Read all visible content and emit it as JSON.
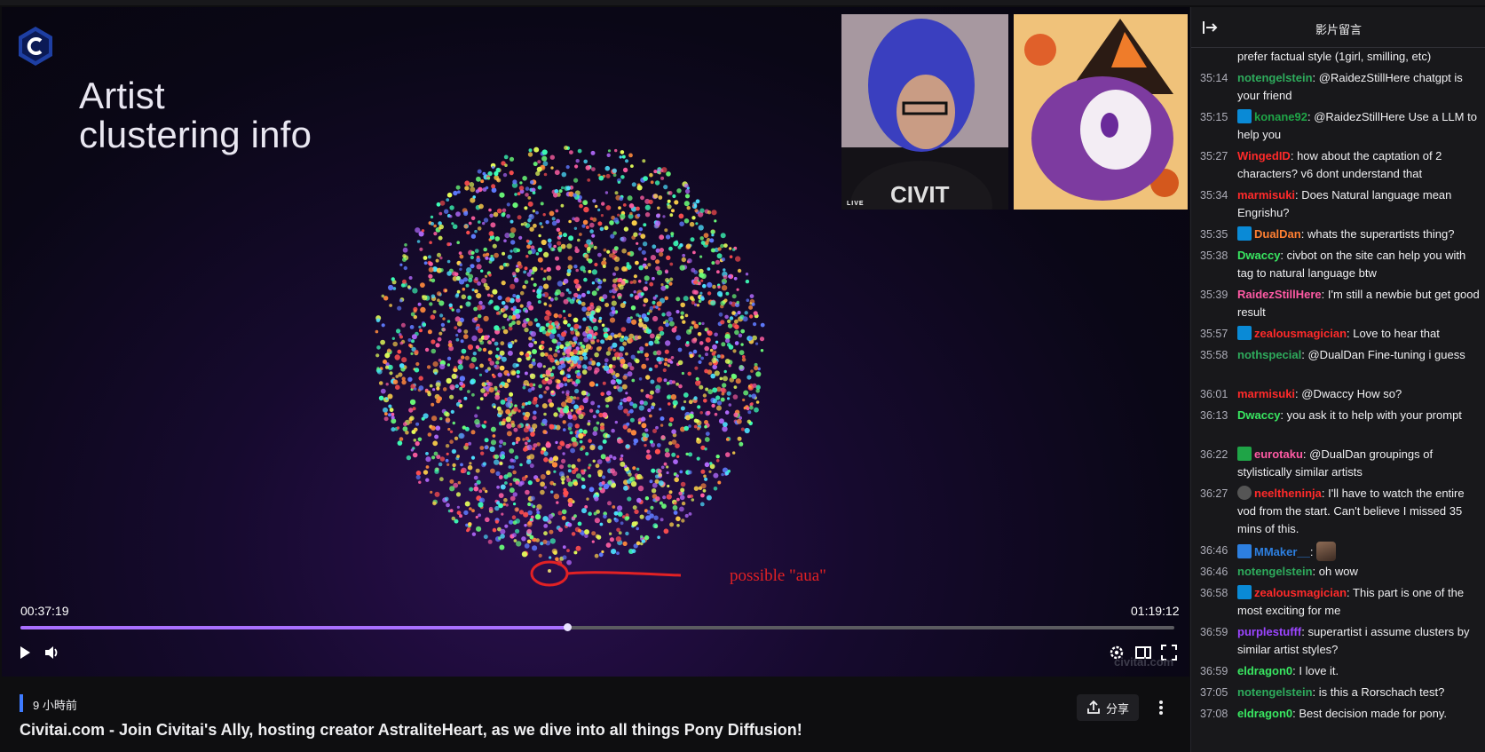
{
  "video": {
    "slide_title_line1": "Artist",
    "slide_title_line2": "clustering info",
    "annotation": "possible \"aua\"",
    "live_tag": "LIVE",
    "current_time": "00:37:19",
    "total_time": "01:19:12",
    "progress": 0.474,
    "watermark": "civitai.com",
    "accent_color": "#a970ff"
  },
  "info": {
    "age": "9 小時前",
    "share_label": "分享",
    "title": "Civitai.com - Join Civitai's Ally, hosting creator AstraliteHeart, as we dive into all things Pony Diffusion!"
  },
  "chat": {
    "title": "影片留言",
    "messages": [
      {
        "ts": "",
        "badge": "",
        "user": "",
        "color": "",
        "text": "prefer factual style (1girl, smilling, etc)"
      },
      {
        "ts": "35:14",
        "badge": "",
        "user": "notengelstein",
        "color": "#2eab5c",
        "text": "@RaidezStillHere chatgpt is your friend"
      },
      {
        "ts": "35:15",
        "badge": "crown",
        "user": "konane92",
        "color": "#1fa447",
        "text": "@RaidezStillHere Use a LLM to help you"
      },
      {
        "ts": "35:27",
        "badge": "",
        "user": "WingedID",
        "color": "#ff2a2a",
        "text": "how about the captation of 2 characters? v6 dont understand that"
      },
      {
        "ts": "35:34",
        "badge": "",
        "user": "marmisuki",
        "color": "#ff2a2a",
        "text": "Does Natural language mean Engrishu?"
      },
      {
        "ts": "35:35",
        "badge": "crown",
        "user": "DualDan",
        "color": "#ff7f32",
        "text": "whats the superartists thing?"
      },
      {
        "ts": "35:38",
        "badge": "",
        "user": "Dwaccy",
        "color": "#39e661",
        "text": "civbot on the site can help you with tag to natural language btw"
      },
      {
        "ts": "35:39",
        "badge": "",
        "user": "RaidezStillHere",
        "color": "#ff5aa4",
        "text": "I'm still a newbie but get good result"
      },
      {
        "ts": "35:57",
        "badge": "crown",
        "user": "zealousmagician",
        "color": "#ff2a2a",
        "text": "Love to hear that"
      },
      {
        "ts": "35:58",
        "badge": "",
        "user": "nothspecial",
        "color": "#2eab5c",
        "text": "@DualDan Fine-tuning i guess"
      },
      {
        "ts": "36:01",
        "badge": "",
        "user": "marmisuki",
        "color": "#ff2a2a",
        "text": "@Dwaccy How so?"
      },
      {
        "ts": "36:13",
        "badge": "",
        "user": "Dwaccy",
        "color": "#39e661",
        "text": "you ask it to help with your prompt"
      },
      {
        "ts": "36:22",
        "badge": "green",
        "user": "eurotaku",
        "color": "#ff5aa4",
        "text": "@DualDan groupings of stylistically similar artists"
      },
      {
        "ts": "36:27",
        "badge": "round",
        "user": "neeltheninja",
        "color": "#ff2a2a",
        "text": "I'll have to watch the entire vod from the start. Can't believe I missed 35 mins of this."
      },
      {
        "ts": "36:46",
        "badge": "blue",
        "user": "MMaker__",
        "color": "#2d7fe0",
        "text": ""
      },
      {
        "ts": "36:46",
        "badge": "",
        "user": "notengelstein",
        "color": "#2eab5c",
        "text": "oh wow"
      },
      {
        "ts": "36:58",
        "badge": "crown",
        "user": "zealousmagician",
        "color": "#ff2a2a",
        "text": "This part is one of the most exciting for me"
      },
      {
        "ts": "36:59",
        "badge": "",
        "user": "purplestufff",
        "color": "#9b45ff",
        "text": "superartist i assume clusters by similar artist styles?"
      },
      {
        "ts": "36:59",
        "badge": "",
        "user": "eldragon0",
        "color": "#39e661",
        "text": "I love it."
      },
      {
        "ts": "37:05",
        "badge": "",
        "user": "notengelstein",
        "color": "#2eab5c",
        "text": "is this a Rorschach test?"
      },
      {
        "ts": "37:08",
        "badge": "",
        "user": "eldragon0",
        "color": "#39e661",
        "text": "Best decision made for pony."
      }
    ]
  }
}
